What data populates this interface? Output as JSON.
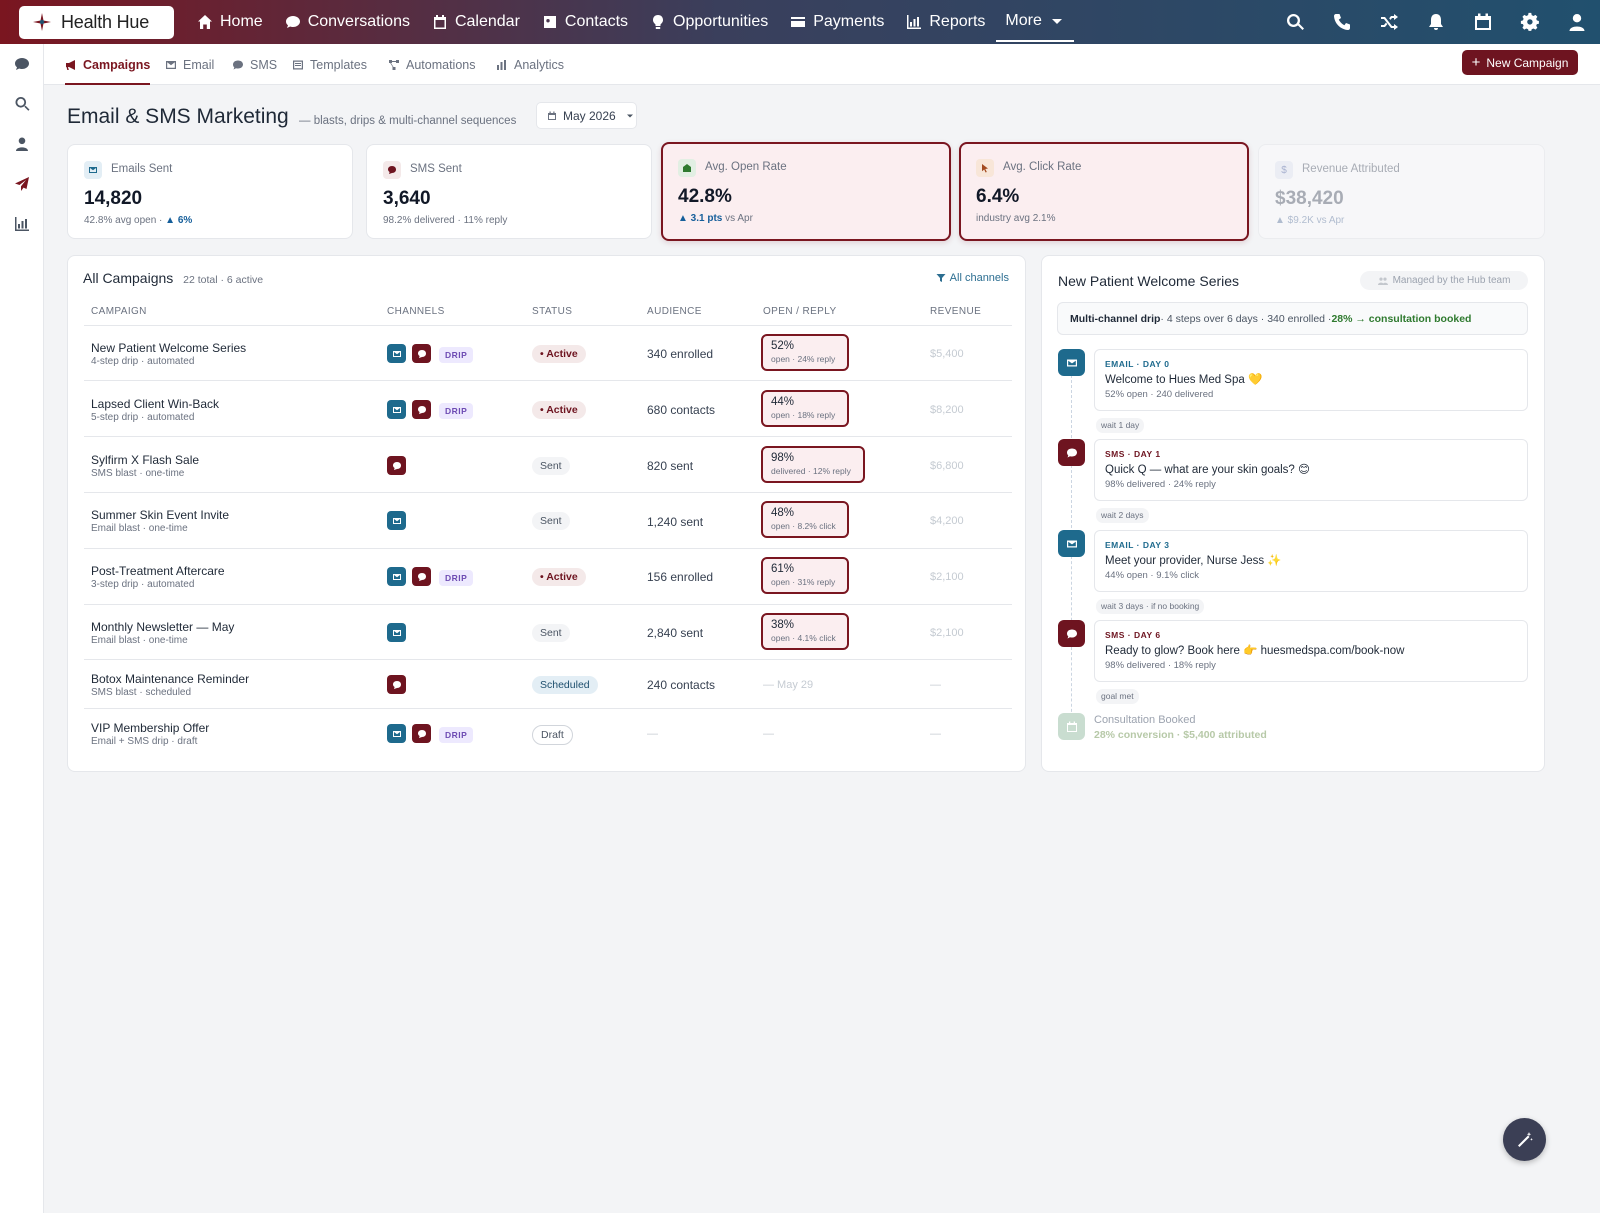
{
  "app": {
    "logo_text": "Health Hue"
  },
  "nav": {
    "items": [
      "Home",
      "Conversations",
      "Calendar",
      "Contacts",
      "Opportunities",
      "Payments",
      "Reports"
    ],
    "more": "More"
  },
  "subtabs": [
    "Campaigns",
    "Email",
    "SMS",
    "Templates",
    "Automations",
    "Analytics"
  ],
  "new_campaign": "New Campaign",
  "header": {
    "title": "Email & SMS Marketing",
    "subtitle": "— blasts, drips & multi-channel sequences",
    "month": "May 2026"
  },
  "stats": [
    {
      "label": "Emails Sent",
      "value": "14,820",
      "sub": "42.8% avg open · ",
      "delta": "▲ 6%",
      "icon": "email-icon"
    },
    {
      "label": "SMS Sent",
      "value": "3,640",
      "sub": "98.2% delivered · 11% reply",
      "delta": "",
      "icon": "chat-icon"
    },
    {
      "label": "Avg. Open Rate",
      "value": "42.8%",
      "sub": " vs Apr",
      "delta": "▲ 3.1 pts",
      "icon": "envelope-open-icon"
    },
    {
      "label": "Avg. Click Rate",
      "value": "6.4%",
      "sub": "industry avg 2.1%",
      "delta": "",
      "icon": "pointer-icon"
    },
    {
      "label": "Revenue Attributed",
      "value": "$38,420",
      "sub": "▲ $9.2K vs Apr",
      "delta": "",
      "icon": "dollar-icon"
    }
  ],
  "campaigns": {
    "title": "All Campaigns",
    "meta": "22 total · 6 active",
    "filter": "All channels",
    "columns": [
      "CAMPAIGN",
      "CHANNELS",
      "STATUS",
      "AUDIENCE",
      "OPEN / REPLY",
      "REVENUE"
    ],
    "drip_label": "DRIP",
    "rows": [
      {
        "name": "New Patient Welcome Series",
        "sub": "4-step drip · automated",
        "status": "• Active",
        "audience": "340 enrolled",
        "rate": "52%",
        "rate_sub": "open · 24% reply",
        "revenue": "$5,400"
      },
      {
        "name": "Lapsed Client Win-Back",
        "sub": "5-step drip · automated",
        "status": "• Active",
        "audience": "680 contacts",
        "rate": "44%",
        "rate_sub": "open · 18% reply",
        "revenue": "$8,200"
      },
      {
        "name": "Sylfirm X Flash Sale",
        "sub": "SMS blast · one-time",
        "status": "Sent",
        "audience": "820 sent",
        "rate": "98%",
        "rate_sub": "delivered · 12% reply",
        "revenue": "$6,800"
      },
      {
        "name": "Summer Skin Event Invite",
        "sub": "Email blast · one-time",
        "status": "Sent",
        "audience": "1,240 sent",
        "rate": "48%",
        "rate_sub": "open · 8.2% click",
        "revenue": "$4,200"
      },
      {
        "name": "Post-Treatment Aftercare",
        "sub": "3-step drip · automated",
        "status": "• Active",
        "audience": "156 enrolled",
        "rate": "61%",
        "rate_sub": "open · 31% reply",
        "revenue": "$2,100"
      },
      {
        "name": "Monthly Newsletter — May",
        "sub": "Email blast · one-time",
        "status": "Sent",
        "audience": "2,840 sent",
        "rate": "38%",
        "rate_sub": "open · 4.1% click",
        "revenue": "$2,100"
      },
      {
        "name": "Botox Maintenance Reminder",
        "sub": "SMS blast · scheduled",
        "status": "Scheduled",
        "audience": "240 contacts",
        "rate": "— May 29",
        "rate_sub": "",
        "revenue": "—"
      },
      {
        "name": "VIP Membership Offer",
        "sub": "Email + SMS drip · draft",
        "status": "Draft",
        "audience": "—",
        "rate": "—",
        "rate_sub": "",
        "revenue": "—"
      }
    ]
  },
  "sequence": {
    "title": "New Patient Welcome Series",
    "managed": "Managed by the Hub team",
    "banner_bold": "Multi-channel drip",
    "banner_mid": " · 4 steps over 6 days · 340 enrolled · ",
    "banner_ok": "28% → consultation booked",
    "steps": [
      {
        "kicker": "EMAIL · DAY 0",
        "title": "Welcome to Hues Med Spa 💛",
        "sub": "52% open · 240 delivered"
      },
      {
        "kicker": "SMS · DAY 1",
        "title": "Quick Q — what are your skin goals? 😊",
        "sub": "98% delivered · 24% reply"
      },
      {
        "kicker": "EMAIL · DAY 3",
        "title": "Meet your provider, Nurse Jess ✨",
        "sub": "44% open · 9.1% click"
      },
      {
        "kicker": "SMS · DAY 6",
        "title": "Ready to glow? Book here 👉 huesmedspa.com/book-now",
        "sub": "98% delivered · 18% reply"
      }
    ],
    "waits": [
      "wait 1 day",
      "wait 2 days",
      "wait 3 days · if no booking",
      "goal met"
    ],
    "goal_title": "Consultation Booked",
    "goal_sub": "28% conversion · $5,400 attributed"
  }
}
